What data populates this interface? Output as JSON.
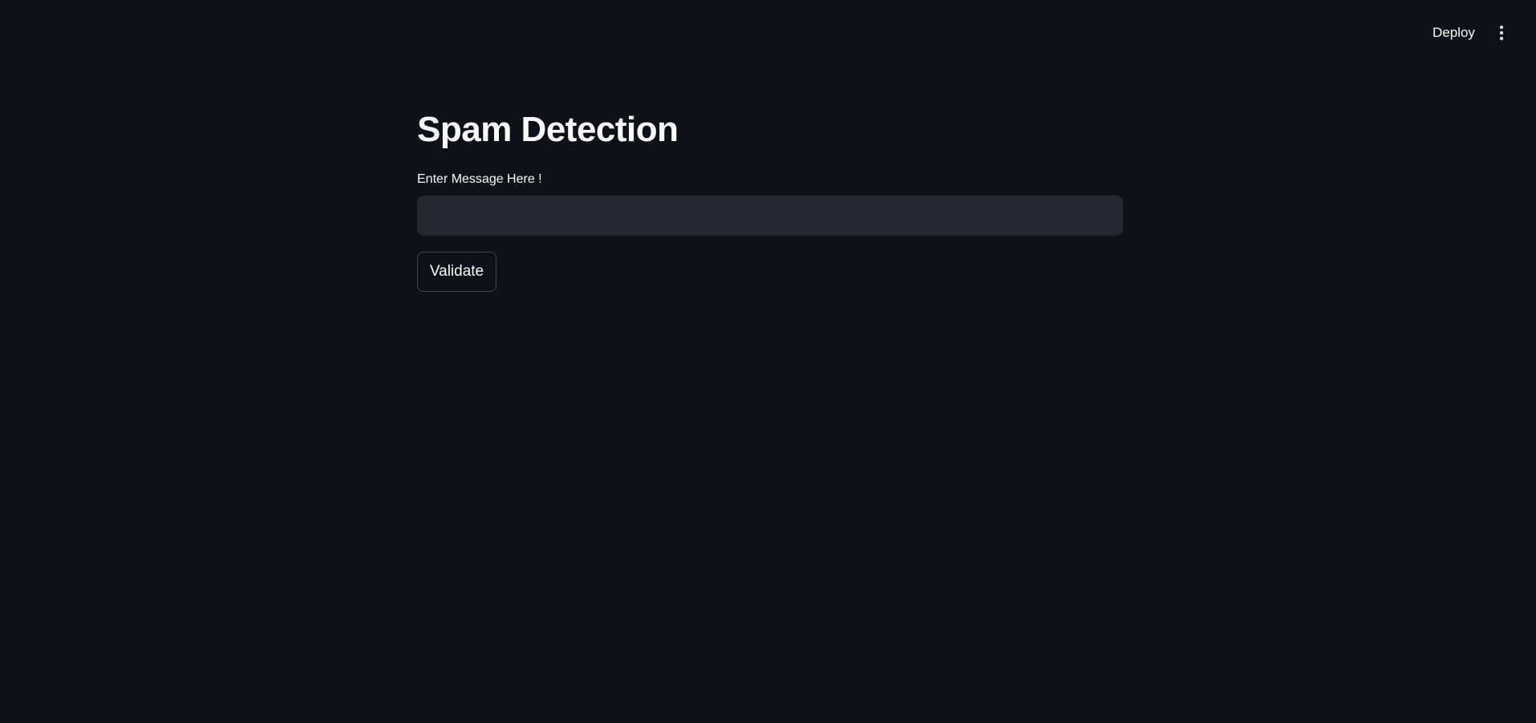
{
  "header": {
    "deploy_label": "Deploy",
    "menu_icon": "vertical-ellipsis-icon"
  },
  "main": {
    "title": "Spam Detection",
    "input_label": "Enter Message Here !",
    "input_value": "",
    "button_label": "Validate"
  }
}
